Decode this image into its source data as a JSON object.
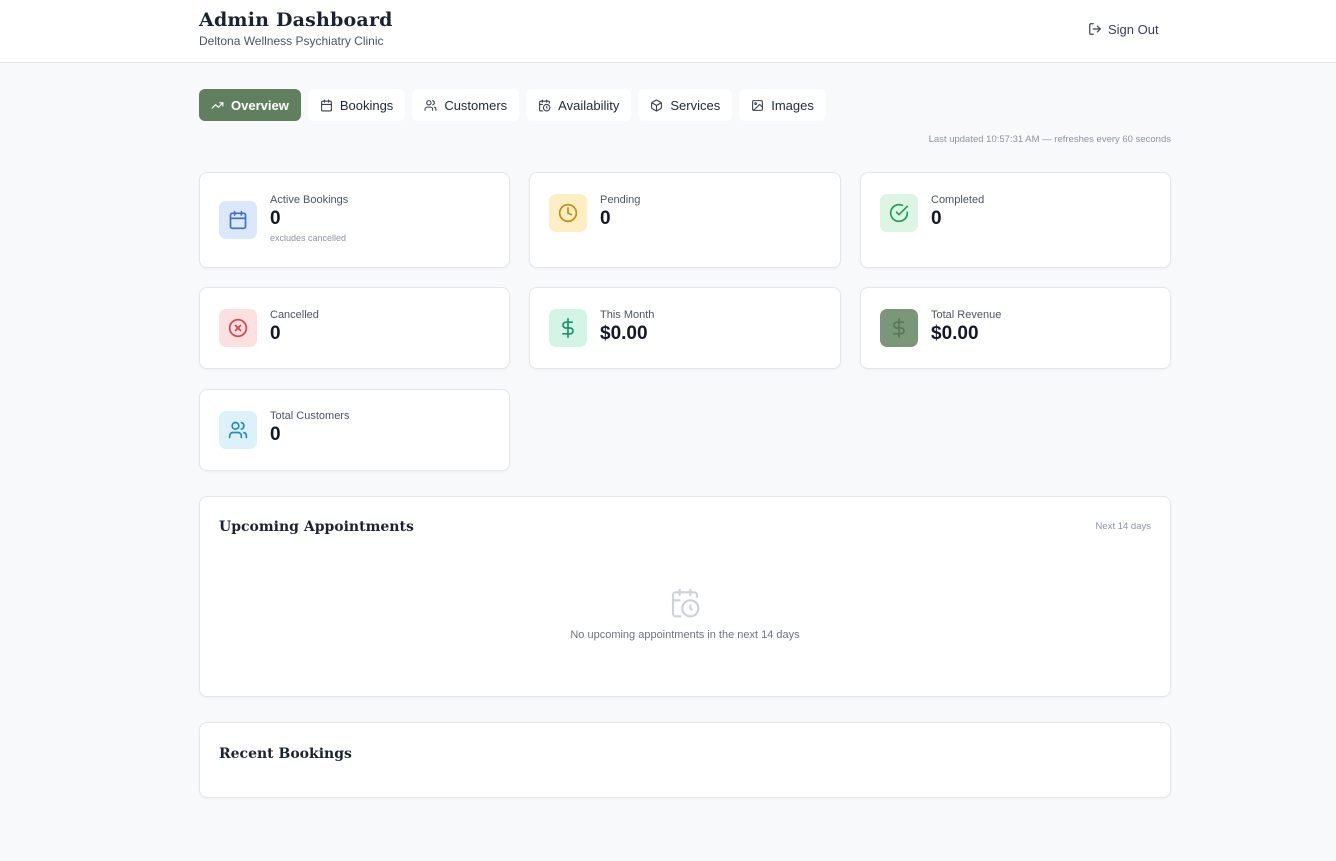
{
  "header": {
    "title": "Admin Dashboard",
    "subtitle": "Deltona Wellness Psychiatry Clinic",
    "sign_out_label": "Sign Out",
    "sign_out_icon": "log-out-icon"
  },
  "tabs": [
    {
      "label": "Overview",
      "icon": "trending-up-icon",
      "active": true
    },
    {
      "label": "Bookings",
      "icon": "calendar-icon",
      "active": false
    },
    {
      "label": "Customers",
      "icon": "users-icon",
      "active": false
    },
    {
      "label": "Availability",
      "icon": "calendar-clock-icon",
      "active": false
    },
    {
      "label": "Services",
      "icon": "package-icon",
      "active": false
    },
    {
      "label": "Images",
      "icon": "image-icon",
      "active": false
    }
  ],
  "last_updated": "Last updated 10:57:31 AM — refreshes every 60 seconds",
  "stats": [
    {
      "label": "Active Bookings",
      "value": "0",
      "note": "excludes cancelled",
      "icon": "calendar-icon",
      "color": "#3b6fd4",
      "bg": "#dbe7fb"
    },
    {
      "label": "Pending",
      "value": "0",
      "icon": "clock-icon",
      "color": "#c98a0c",
      "bg": "#fdefc3"
    },
    {
      "label": "Completed",
      "value": "0",
      "icon": "check-circle-icon",
      "color": "#1f9d55",
      "bg": "#dcf5e5"
    },
    {
      "label": "Cancelled",
      "value": "0",
      "icon": "x-circle-icon",
      "color": "#d9434a",
      "bg": "#fde0e0"
    },
    {
      "label": "This Month",
      "value": "$0.00",
      "icon": "dollar-icon",
      "color": "#14946b",
      "bg": "#d4f5e6"
    },
    {
      "label": "Total Revenue",
      "value": "$0.00",
      "icon": "dollar-icon",
      "color": "#5f7f5f",
      "bg": "#7a977a"
    },
    {
      "label": "Total Customers",
      "value": "0",
      "icon": "users-icon",
      "color": "#1d8fb8",
      "bg": "#dcf1fa"
    }
  ],
  "upcoming": {
    "title": "Upcoming Appointments",
    "meta": "Next 14 days",
    "empty_text": "No upcoming appointments in the next 14 days",
    "empty_icon": "calendar-clock-icon"
  },
  "recent": {
    "title": "Recent Bookings"
  }
}
